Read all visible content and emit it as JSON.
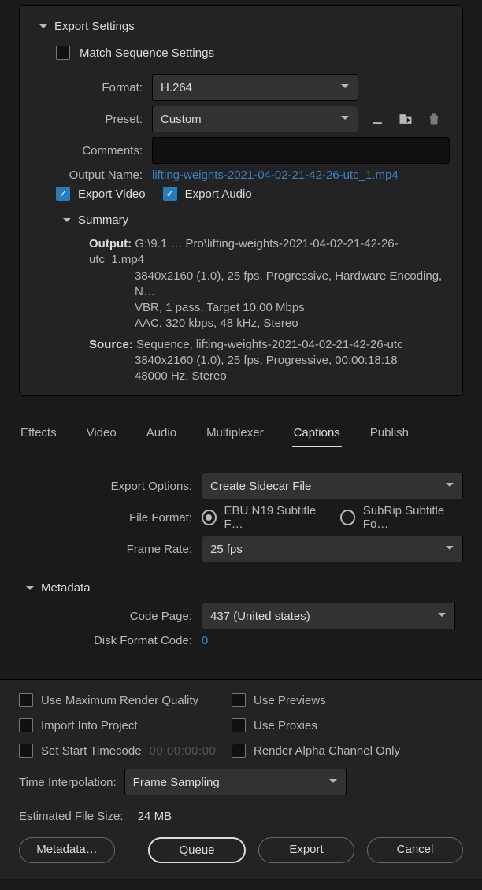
{
  "header": {
    "title": "Export Settings"
  },
  "matchSeq": {
    "label": "Match Sequence Settings",
    "checked": false
  },
  "format": {
    "label": "Format:",
    "value": "H.264"
  },
  "preset": {
    "label": "Preset:",
    "value": "Custom"
  },
  "comments": {
    "label": "Comments:",
    "value": ""
  },
  "outputName": {
    "label": "Output Name:",
    "value": "lifting-weights-2021-04-02-21-42-26-utc_1.mp4"
  },
  "exportVideo": {
    "label": "Export Video",
    "checked": true
  },
  "exportAudio": {
    "label": "Export Audio",
    "checked": true
  },
  "summary": {
    "title": "Summary",
    "output": {
      "k": "Output:",
      "l1": "G:\\9.1 … Pro\\lifting-weights-2021-04-02-21-42-26-utc_1.mp4",
      "l2": "3840x2160 (1.0), 25 fps, Progressive, Hardware Encoding, N…",
      "l3": "VBR, 1 pass, Target 10.00 Mbps",
      "l4": "AAC, 320 kbps, 48 kHz, Stereo"
    },
    "source": {
      "k": "Source:",
      "l1": "Sequence, lifting-weights-2021-04-02-21-42-26-utc",
      "l2": "3840x2160 (1.0), 25 fps, Progressive, 00:00:18:18",
      "l3": "48000 Hz, Stereo"
    }
  },
  "tabs": {
    "effects": "Effects",
    "video": "Video",
    "audio": "Audio",
    "multiplexer": "Multiplexer",
    "captions": "Captions",
    "publish": "Publish",
    "active": "captions"
  },
  "captions": {
    "exportOptions": {
      "label": "Export Options:",
      "value": "Create Sidecar File"
    },
    "fileFormat": {
      "label": "File Format:",
      "opt1": "EBU N19 Subtitle F…",
      "opt2": "SubRip Subtitle Fo…"
    },
    "frameRate": {
      "label": "Frame Rate:",
      "value": "25 fps"
    }
  },
  "metadata": {
    "title": "Metadata",
    "codePage": {
      "label": "Code Page:",
      "value": "437 (United states)"
    },
    "diskFormatCode": {
      "label": "Disk Format Code:",
      "value": "0"
    }
  },
  "lower": {
    "useMaxRender": {
      "label": "Use Maximum Render Quality",
      "checked": false
    },
    "usePreviews": {
      "label": "Use Previews",
      "checked": false
    },
    "importIntoProject": {
      "label": "Import Into Project",
      "checked": false
    },
    "useProxies": {
      "label": "Use Proxies",
      "checked": false
    },
    "setStartTC": {
      "label": "Set Start Timecode",
      "checked": false,
      "placeholder": "00:00:00:00"
    },
    "renderAlpha": {
      "label": "Render Alpha Channel Only",
      "checked": false
    },
    "timeInterp": {
      "label": "Time Interpolation:",
      "value": "Frame Sampling"
    },
    "est": {
      "label": "Estimated File Size:",
      "value": "24 MB"
    }
  },
  "buttons": {
    "metadata": "Metadata…",
    "queue": "Queue",
    "export": "Export",
    "cancel": "Cancel"
  }
}
